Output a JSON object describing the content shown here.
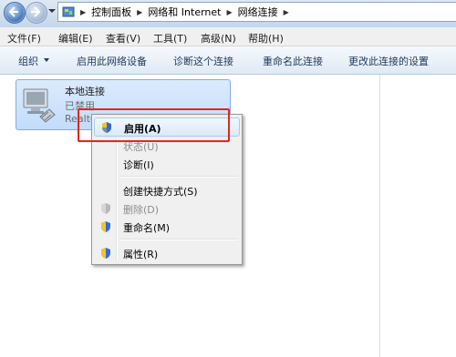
{
  "address_bar": {
    "breadcrumbs": [
      "控制面板",
      "网络和 Internet",
      "网络连接"
    ]
  },
  "menu": {
    "items": [
      "文件(F)",
      "编辑(E)",
      "查看(V)",
      "工具(T)",
      "高级(N)",
      "帮助(H)"
    ]
  },
  "commands": {
    "organize": "组织",
    "items": [
      "启用此网络设备",
      "诊断这个连接",
      "重命名此连接",
      "更改此连接的设置"
    ]
  },
  "connection": {
    "name": "本地连接",
    "status": "已禁用",
    "device": "Realte"
  },
  "context_menu": {
    "items": [
      {
        "label": "启用(A)",
        "state": "default-highlighted",
        "icon": "shield-icon"
      },
      {
        "label": "状态(U)",
        "state": "disabled"
      },
      {
        "label": "诊断(I)",
        "state": "enabled"
      },
      {
        "label": "创建快捷方式(S)",
        "state": "enabled"
      },
      {
        "label": "删除(D)",
        "state": "disabled",
        "icon": "shield-icon"
      },
      {
        "label": "重命名(M)",
        "state": "enabled",
        "icon": "shield-icon"
      },
      {
        "label": "属性(R)",
        "state": "enabled",
        "icon": "shield-icon"
      }
    ]
  },
  "colors": {
    "highlight_box": "#e8231c",
    "selection": "#c1dcfc",
    "command_text": "#1e395b"
  }
}
